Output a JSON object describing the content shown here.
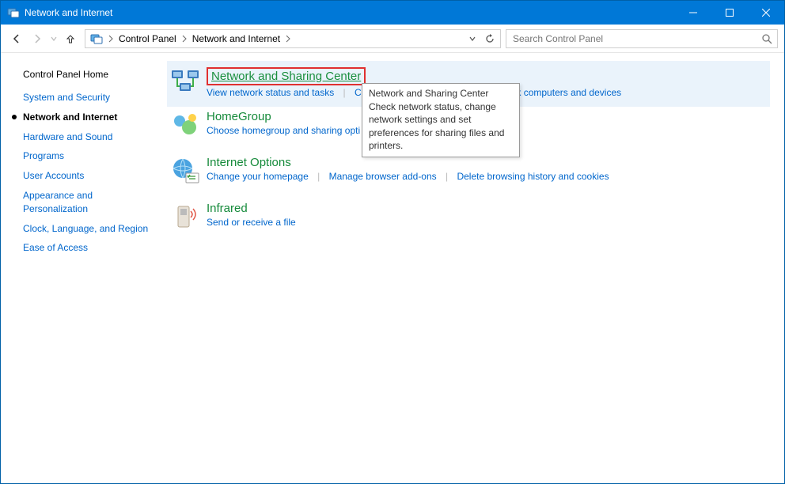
{
  "window": {
    "title": "Network and Internet"
  },
  "breadcrumb": {
    "root": "Control Panel",
    "current": "Network and Internet"
  },
  "search": {
    "placeholder": "Search Control Panel"
  },
  "sidebar": {
    "home": "Control Panel Home",
    "items": [
      "System and Security",
      "Network and Internet",
      "Hardware and Sound",
      "Programs",
      "User Accounts",
      "Appearance and Personalization",
      "Clock, Language, and Region",
      "Ease of Access"
    ]
  },
  "categories": [
    {
      "title": "Network and Sharing Center",
      "links": [
        "View network status and tasks",
        "Connect to a network",
        "View network computers and devices"
      ]
    },
    {
      "title": "HomeGroup",
      "links": [
        "Choose homegroup and sharing opti"
      ]
    },
    {
      "title": "Internet Options",
      "links": [
        "Change your homepage",
        "Manage browser add-ons",
        "Delete browsing history and cookies"
      ]
    },
    {
      "title": "Infrared",
      "links": [
        "Send or receive a file"
      ]
    }
  ],
  "tooltip": {
    "title": "Network and Sharing Center",
    "body": "Check network status, change network settings and set preferences for sharing files and printers."
  }
}
